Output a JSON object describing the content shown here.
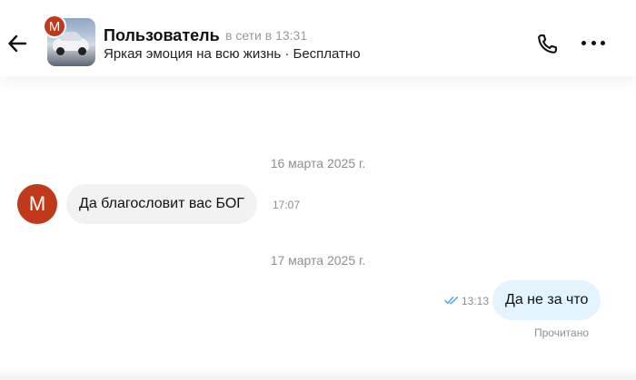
{
  "header": {
    "user_name": "Пользователь",
    "status": "в сети в 13:31",
    "ad_title": "Яркая эмоция на всю жизнь · Бесплатно",
    "avatar_letter": "M"
  },
  "icons": {
    "back": "arrow-left-icon",
    "call": "phone-icon",
    "more": "more-dots-icon",
    "read": "double-check-icon"
  },
  "colors": {
    "avatar": "#c0391b",
    "incoming_bubble": "#f2f2f2",
    "outgoing_bubble": "#e3f3ff",
    "read_check": "#4a9ee8",
    "secondary_text": "#8e8e8e"
  },
  "messages": [
    {
      "date": "16 марта 2025 г.",
      "direction": "in",
      "text": "Да благословит вас БОГ",
      "time": "17:07",
      "avatar_letter": "M"
    },
    {
      "date": "17 марта 2025 г.",
      "direction": "out",
      "text": "Да не за что",
      "time": "13:13",
      "status": "Прочитано"
    }
  ]
}
